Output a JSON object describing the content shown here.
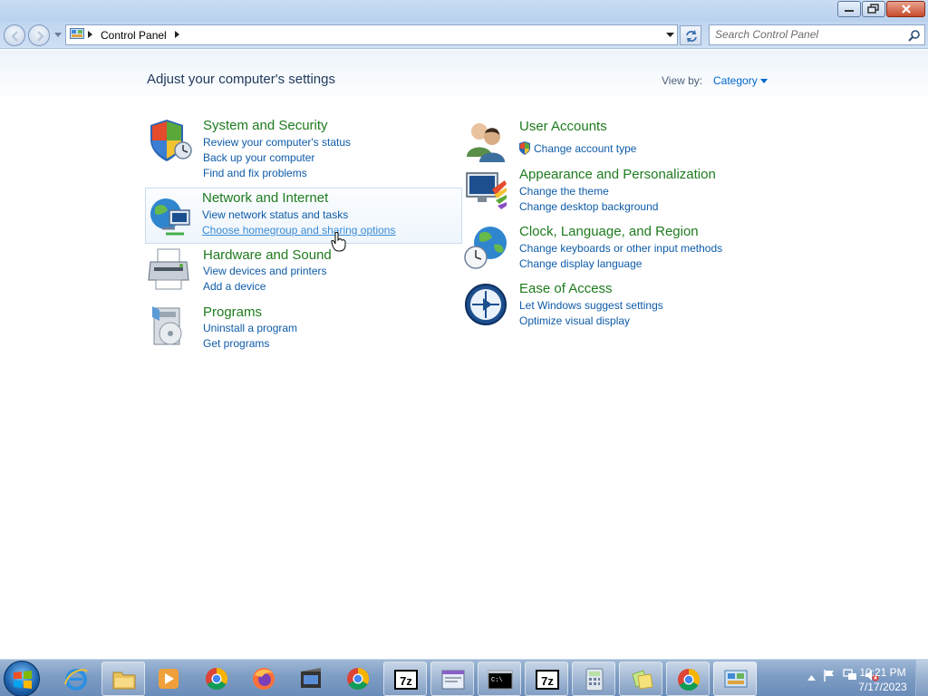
{
  "window": {
    "minimize_label": "",
    "restore_label": "",
    "close_label": ""
  },
  "address_bar": {
    "breadcrumb": "Control Panel"
  },
  "search": {
    "placeholder": "Search Control Panel"
  },
  "header": {
    "title": "Adjust your computer's settings",
    "view_by_label": "View by:",
    "view_by_value": "Category"
  },
  "categories_left": [
    {
      "title": "System and Security",
      "icon": "shield-icon",
      "links": [
        "Review your computer's status",
        "Back up your computer",
        "Find and fix problems"
      ]
    },
    {
      "title": "Network and Internet",
      "icon": "network-globe-icon",
      "links": [
        "View network status and tasks",
        "Choose homegroup and sharing options"
      ]
    },
    {
      "title": "Hardware and Sound",
      "icon": "printer-icon",
      "links": [
        "View devices and printers",
        "Add a device"
      ]
    },
    {
      "title": "Programs",
      "icon": "programs-icon",
      "links": [
        "Uninstall a program",
        "Get programs"
      ]
    }
  ],
  "categories_right": [
    {
      "title": "User Accounts",
      "icon": "users-icon",
      "links": [
        "Change account type"
      ]
    },
    {
      "title": "Appearance and Personalization",
      "icon": "monitor-paint-icon",
      "links": [
        "Change the theme",
        "Change desktop background"
      ]
    },
    {
      "title": "Clock, Language, and Region",
      "icon": "globe-clock-icon",
      "links": [
        "Change keyboards or other input methods",
        "Change display language"
      ]
    },
    {
      "title": "Ease of Access",
      "icon": "ease-of-access-icon",
      "links": [
        "Let Windows suggest settings",
        "Optimize visual display"
      ]
    }
  ],
  "taskbar": {
    "items": [
      "internet-explorer-icon",
      "windows-explorer-icon",
      "media-player-icon",
      "chrome-icon",
      "firefox-icon",
      "movie-maker-icon",
      "chrome-icon",
      "7zip-icon",
      "window-icon",
      "command-prompt-icon",
      "7zip-icon",
      "calculator-icon",
      "sticky-notes-icon",
      "chrome-icon",
      "control-panel-icon"
    ],
    "seven_zip_label": "7z",
    "cmd_label": "C:\\",
    "clock_time": "10:21 PM",
    "clock_date": "7/17/2023"
  },
  "colors": {
    "link": "#0e5ba8",
    "category_title": "#1e7b1e",
    "heading": "#1e395b"
  }
}
